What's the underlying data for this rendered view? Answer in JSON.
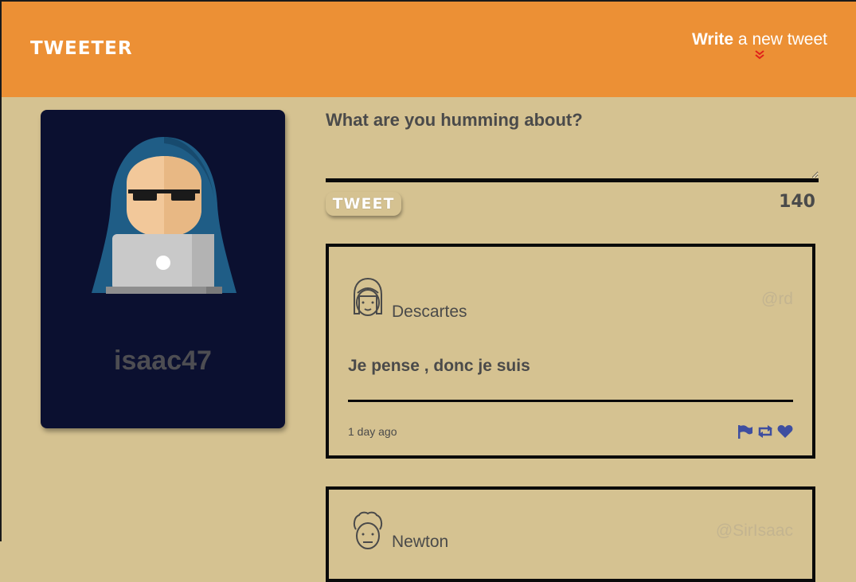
{
  "nav": {
    "brand": "TWEETER",
    "compose_bold": "Write",
    "compose_rest": " a new tweet"
  },
  "profile": {
    "username": "isaac47"
  },
  "compose": {
    "label": "What are you humming about?",
    "placeholder": "",
    "button_label": "TWEET",
    "counter": "140"
  },
  "tweets": [
    {
      "name": "Descartes",
      "handle": "@rd",
      "body": "Je pense , donc je suis",
      "time": "1 day ago"
    },
    {
      "name": "Newton",
      "handle": "@SirIsaac"
    }
  ],
  "colors": {
    "nav": "#ec9035",
    "background": "#d5c291",
    "card": "#0b1030",
    "action_icons": "#3e4ea0",
    "chevron": "#e0201a"
  }
}
